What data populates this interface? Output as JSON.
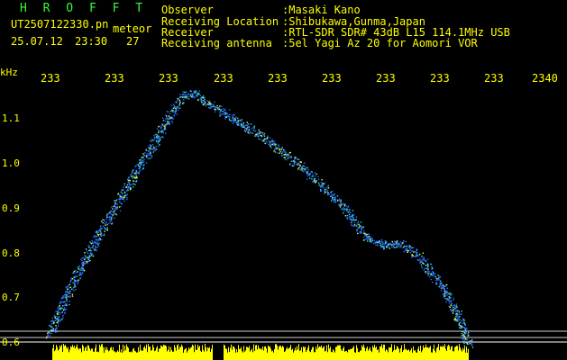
{
  "header": {
    "title": "H R O F F T",
    "filename": "UT2507122330.pn",
    "mode": "meteor",
    "date": "25.07.12",
    "time": "23:30",
    "count": "27",
    "fields": [
      {
        "label": "Observer",
        "value": ":Masaki Kano"
      },
      {
        "label": "Receiving Location",
        "value": ":Shibukawa,Gunma,Japan"
      },
      {
        "label": "Receiver",
        "value": ":RTL-SDR SDR# 43dB L15 114.1MHz USB"
      },
      {
        "label": "Receiving antenna",
        "value": ":5el Yagi Az 20 for Aomori VOR"
      }
    ]
  },
  "axis": {
    "y_unit": "kHz",
    "y_ticks": [
      "1.1",
      "1.0",
      "0.9",
      "0.8",
      "0.7",
      "0.6"
    ],
    "x_ticks": [
      "233",
      "233",
      "233",
      "233",
      "233",
      "233",
      "233",
      "233",
      "233",
      "2340"
    ]
  },
  "colors": {
    "background": "#000000",
    "text_yellow": "#ffff00",
    "text_green": "#33ff33",
    "signal_blue": "#2b6cff",
    "signal_cyan": "#33ddff",
    "signal_yellow": "#e8ff40",
    "noise_bar": "#ffff00",
    "baseline": "#ffffff"
  }
}
